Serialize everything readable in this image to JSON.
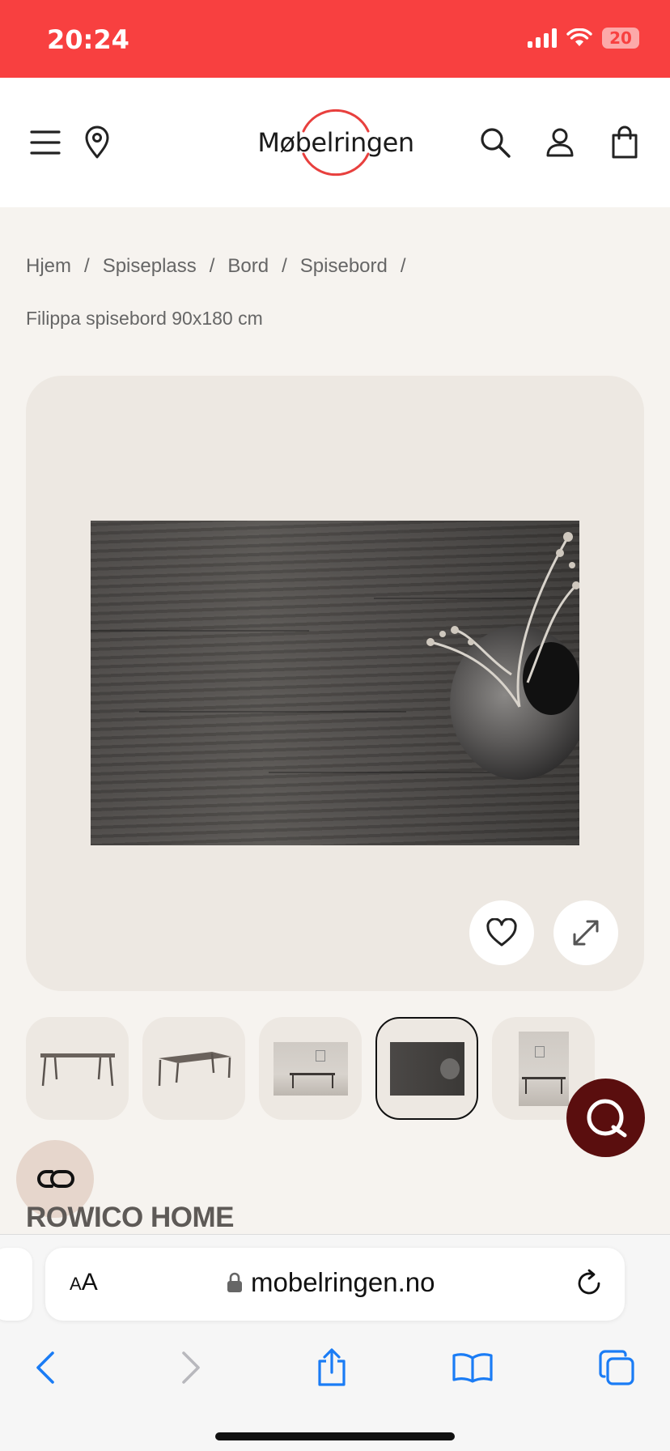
{
  "status_bar": {
    "time": "20:24",
    "battery": "20"
  },
  "header": {
    "logo_text": "Møbelringen",
    "brand_color": "#e8403e"
  },
  "breadcrumb": {
    "items": [
      "Hjem",
      "Spiseplass",
      "Bord",
      "Spisebord"
    ],
    "separator": "/",
    "current": "Filippa spisebord 90x180 cm"
  },
  "gallery": {
    "thumbnails_count": 5,
    "active_thumbnail": 4
  },
  "product": {
    "brand": "ROWICO HOME"
  },
  "browser": {
    "aa_large": "A",
    "aa_small": "A",
    "url": "mobelringen.no"
  },
  "icons": {
    "header": [
      "menu-icon",
      "location-pin-icon",
      "search-icon",
      "account-icon",
      "cart-bag-icon"
    ],
    "gallery": [
      "heart-icon",
      "expand-icon"
    ],
    "chat": "chat-bubble-icon",
    "cookie": "cookie-consent-icon",
    "browser": [
      "lock-icon",
      "reload-icon",
      "back-icon",
      "forward-icon",
      "share-icon",
      "bookmarks-icon",
      "tabs-icon"
    ]
  },
  "colors": {
    "status_bar": "#f84040",
    "chat_button": "#5a0e0e",
    "ios_blue": "#1a7cf5"
  }
}
